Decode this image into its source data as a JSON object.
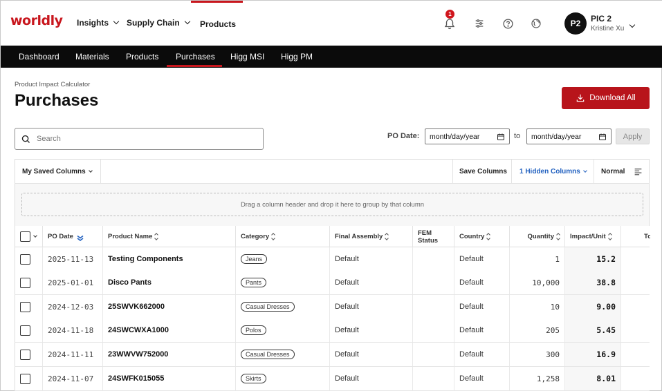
{
  "brand": {
    "logo_text": "worldly",
    "accent": "#c8161d"
  },
  "top_nav": [
    {
      "label": "Insights",
      "has_menu": true
    },
    {
      "label": "Supply Chain",
      "has_menu": true
    },
    {
      "label": "Products",
      "has_menu": false,
      "active": true
    }
  ],
  "header_icons": {
    "notifications_count": "1",
    "notifications_icon": "bell-icon",
    "settings_icon": "sliders-icon",
    "help_icon": "help-circle-icon",
    "language_icon": "globe-icon"
  },
  "user": {
    "initials": "P2",
    "name": "PIC 2",
    "subtitle": "Kristine Xu"
  },
  "sub_nav": [
    {
      "label": "Dashboard"
    },
    {
      "label": "Materials"
    },
    {
      "label": "Products"
    },
    {
      "label": "Purchases",
      "active": true
    },
    {
      "label": "Higg MSI"
    },
    {
      "label": "Higg PM"
    }
  ],
  "page": {
    "breadcrumb": "Product Impact Calculator",
    "title": "Purchases",
    "download_label": "Download All"
  },
  "filters": {
    "search_placeholder": "Search",
    "po_date_label": "PO Date:",
    "from_placeholder": "month/day/year",
    "to_label": "to",
    "to_placeholder": "month/day/year",
    "apply_label": "Apply"
  },
  "grid_toolbar": {
    "saved_columns": "My Saved Columns",
    "save_columns": "Save Columns",
    "hidden_columns": "1 Hidden Columns",
    "density": "Normal"
  },
  "group_hint": "Drag a column header and drop it here to group by that column",
  "columns": [
    "PO Date",
    "Product Name",
    "Category",
    "Final Assembly",
    "FEM Status",
    "Country",
    "Quantity",
    "Impact/Unit",
    "To"
  ],
  "rows": [
    {
      "po_date": "2025-11-13",
      "product": "Testing Components",
      "category": "Jeans",
      "final_assembly": "Default",
      "fem_status": "",
      "country": "Default",
      "quantity": "1",
      "impact": "15.2"
    },
    {
      "po_date": "2025-01-01",
      "product": "Disco Pants",
      "category": "Pants",
      "final_assembly": "Default",
      "fem_status": "",
      "country": "Default",
      "quantity": "10,000",
      "impact": "38.8"
    },
    {
      "po_date": "2024-12-03",
      "product": "25SWVK662000",
      "category": "Casual Dresses",
      "final_assembly": "Default",
      "fem_status": "",
      "country": "Default",
      "quantity": "10",
      "impact": "9.00"
    },
    {
      "po_date": "2024-11-18",
      "product": "24SWCWXA1000",
      "category": "Polos",
      "final_assembly": "Default",
      "fem_status": "",
      "country": "Default",
      "quantity": "205",
      "impact": "5.45"
    },
    {
      "po_date": "2024-11-11",
      "product": "23WWVW752000",
      "category": "Casual Dresses",
      "final_assembly": "Default",
      "fem_status": "",
      "country": "Default",
      "quantity": "300",
      "impact": "16.9"
    },
    {
      "po_date": "2024-11-07",
      "product": "24SWFK015055",
      "category": "Skirts",
      "final_assembly": "Default",
      "fem_status": "",
      "country": "Default",
      "quantity": "1,258",
      "impact": "8.01"
    }
  ]
}
